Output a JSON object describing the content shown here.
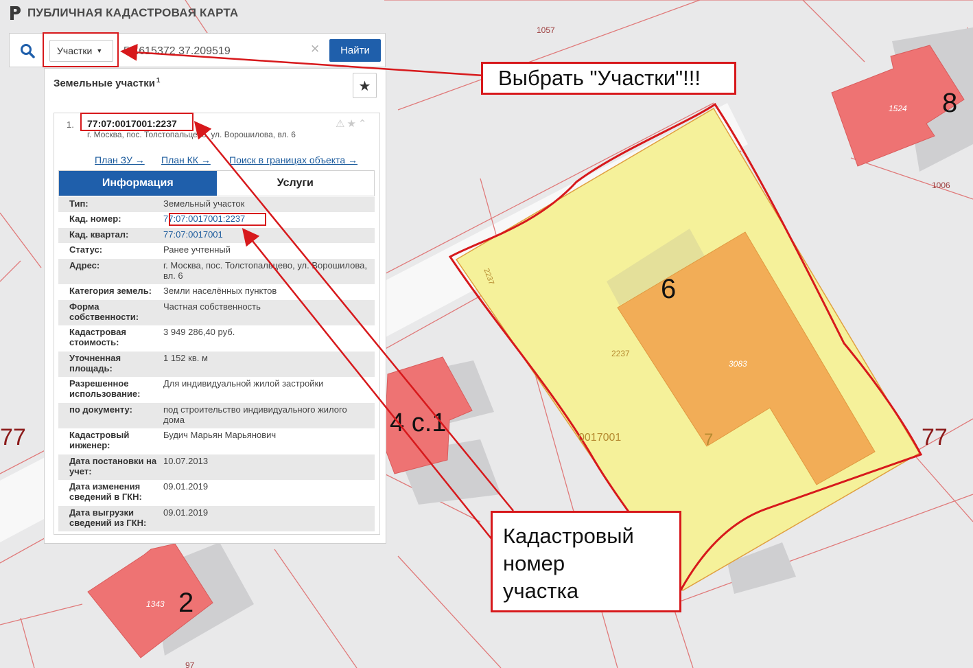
{
  "app": {
    "title": "ПУБЛИЧНАЯ КАДАСТРОВАЯ КАРТА"
  },
  "search": {
    "type_label": "Участки",
    "value": "55.615372 37.209519",
    "clear_glyph": "×",
    "find_label": "Найти"
  },
  "panel": {
    "heading": "Земельные участки",
    "count": "1",
    "favorite_glyph": "★",
    "item": {
      "index": "1.",
      "cad_number": "77:07:0017001:2237",
      "address": "г. Москва, пос. Толстопальцево, ул. Ворошилова, вл. 6",
      "icons": "⚠★⌃",
      "links": [
        "План ЗУ →",
        "План КК →",
        "Поиск в границах объекта →"
      ]
    },
    "tabs": [
      "Информация",
      "Услуги"
    ],
    "rows": [
      {
        "label": "Тип:",
        "value": "Земельный участок"
      },
      {
        "label": "Кад. номер:",
        "value": "77:07:0017001:2237"
      },
      {
        "label": "Кад. квартал:",
        "value": "77:07:0017001"
      },
      {
        "label": "Статус:",
        "value": "Ранее учтенный"
      },
      {
        "label": "Адрес:",
        "value": "г. Москва, пос. Толстопальцево, ул. Ворошилова, вл. 6"
      },
      {
        "label": "Категория земель:",
        "value": "Земли населённых пунктов"
      },
      {
        "label": "Форма собственности:",
        "value": "Частная собственность"
      },
      {
        "label": "Кадастровая стоимость:",
        "value": "3 949 286,40 руб."
      },
      {
        "label": "Уточненная площадь:",
        "value": "1 152 кв. м"
      },
      {
        "label": "Разрешенное использование:",
        "value": "Для индивидуальной жилой застройки"
      },
      {
        "label": "по документу:",
        "value": "под строительство индивидуального жилого дома"
      },
      {
        "label": "Кадастровый инженер:",
        "value": "Будич Марьян Марьянович"
      },
      {
        "label": "Дата постановки на учет:",
        "value": "10.07.2013"
      },
      {
        "label": "Дата изменения сведений в ГКН:",
        "value": "09.01.2019"
      },
      {
        "label": "Дата выгрузки сведений из ГКН:",
        "value": "09.01.2019"
      }
    ]
  },
  "map_labels": {
    "l1057": "1057",
    "l1524": "1524",
    "n8": "8",
    "l1006": "1006",
    "l2237a": "2237",
    "n6": "6",
    "l2237b": "2237",
    "l3083": "3083",
    "quarter": "0017001",
    "n7": "7",
    "n77a": "77",
    "n77b": "77",
    "n4c1": "4 с.1",
    "l1343": "1343",
    "n2": "2",
    "l97": "97"
  },
  "annotations": {
    "select_note": "Выбрать \"Участки\"!!!",
    "cadnum_note": [
      "Кадастровый",
      "номер",
      "участка"
    ]
  },
  "colors": {
    "accent": "#1f5fab",
    "annotation": "#d7191c",
    "parcel_fill": "#f5f19a",
    "building_fill": "#f2ad57",
    "neighbor_building": "#ee7373"
  }
}
